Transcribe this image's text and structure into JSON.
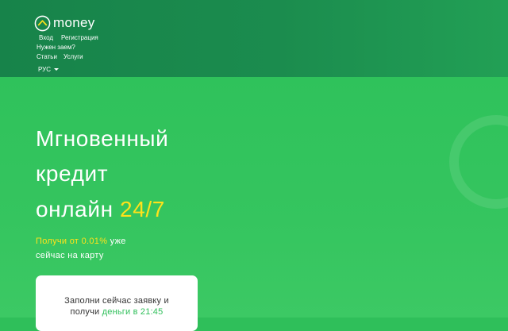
{
  "brand": {
    "name": "money"
  },
  "nav": {
    "login": "Вход",
    "register": "Регистрация",
    "need_loan": "Нужен заем?",
    "articles": "Статьи",
    "services": "Услуги",
    "language": "РУС"
  },
  "hero": {
    "title_line1": "Мгновенный",
    "title_line2": "кредит",
    "title_line3": "онлайн",
    "title_accent": "24/7",
    "sub_highlight": "Получи от 0.01%",
    "sub_rest1": "уже",
    "sub_line2": "сейчас на карту"
  },
  "card": {
    "line1": "Заполни сейчас заявку и",
    "line2_pre": "получи",
    "line2_highlight": "деньги в 21:45"
  },
  "colors": {
    "header": "#17834a",
    "hero": "#2fc25b",
    "accent_yellow": "#ffe21a",
    "text_green": "#2fbf5a"
  }
}
